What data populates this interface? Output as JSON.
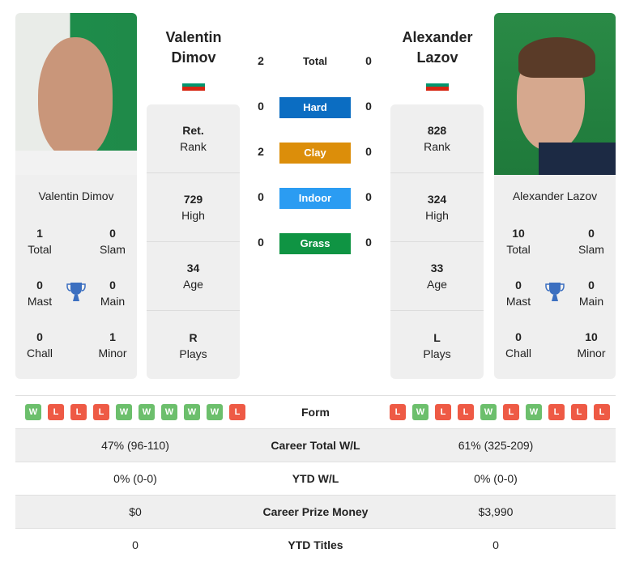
{
  "players": {
    "left": {
      "name_line1": "Valentin",
      "name_line2": "Dimov",
      "full_name": "Valentin Dimov",
      "flag": [
        "#ffffff",
        "#00966e",
        "#d62612"
      ],
      "titles": {
        "total": {
          "value": "1",
          "label": "Total"
        },
        "slam": {
          "value": "0",
          "label": "Slam"
        },
        "mast": {
          "value": "0",
          "label": "Mast"
        },
        "main": {
          "value": "0",
          "label": "Main"
        },
        "chall": {
          "value": "0",
          "label": "Chall"
        },
        "minor": {
          "value": "1",
          "label": "Minor"
        }
      },
      "info": [
        {
          "value": "Ret.",
          "label": "Rank"
        },
        {
          "value": "729",
          "label": "High"
        },
        {
          "value": "34",
          "label": "Age"
        },
        {
          "value": "R",
          "label": "Plays"
        }
      ],
      "form": [
        "W",
        "L",
        "L",
        "L",
        "W",
        "W",
        "W",
        "W",
        "W",
        "L"
      ]
    },
    "right": {
      "name_line1": "Alexander",
      "name_line2": "Lazov",
      "full_name": "Alexander Lazov",
      "flag": [
        "#ffffff",
        "#00966e",
        "#d62612"
      ],
      "titles": {
        "total": {
          "value": "10",
          "label": "Total"
        },
        "slam": {
          "value": "0",
          "label": "Slam"
        },
        "mast": {
          "value": "0",
          "label": "Mast"
        },
        "main": {
          "value": "0",
          "label": "Main"
        },
        "chall": {
          "value": "0",
          "label": "Chall"
        },
        "minor": {
          "value": "10",
          "label": "Minor"
        }
      },
      "info": [
        {
          "value": "828",
          "label": "Rank"
        },
        {
          "value": "324",
          "label": "High"
        },
        {
          "value": "33",
          "label": "Age"
        },
        {
          "value": "L",
          "label": "Plays"
        }
      ],
      "form": [
        "L",
        "W",
        "L",
        "L",
        "W",
        "L",
        "W",
        "L",
        "L",
        "L"
      ]
    }
  },
  "h2h": {
    "total": {
      "label": "Total",
      "left": "2",
      "right": "0"
    },
    "surfaces": [
      {
        "label": "Hard",
        "left": "0",
        "right": "0",
        "color": "#0b6dc2"
      },
      {
        "label": "Clay",
        "left": "2",
        "right": "0",
        "color": "#dc8e0a"
      },
      {
        "label": "Indoor",
        "left": "0",
        "right": "0",
        "color": "#2b9cf2"
      },
      {
        "label": "Grass",
        "left": "0",
        "right": "0",
        "color": "#0f9443"
      }
    ]
  },
  "comparison": {
    "form_label": "Form",
    "rows": [
      {
        "label": "Career Total W/L",
        "left": "47% (96-110)",
        "right": "61% (325-209)"
      },
      {
        "label": "YTD W/L",
        "left": "0% (0-0)",
        "right": "0% (0-0)"
      },
      {
        "label": "Career Prize Money",
        "left": "$0",
        "right": "$3,990"
      },
      {
        "label": "YTD Titles",
        "left": "0",
        "right": "0"
      }
    ]
  },
  "colors": {
    "win": "#6cbf6c",
    "loss": "#ee5a45",
    "trophy": "#3b6fc0"
  }
}
